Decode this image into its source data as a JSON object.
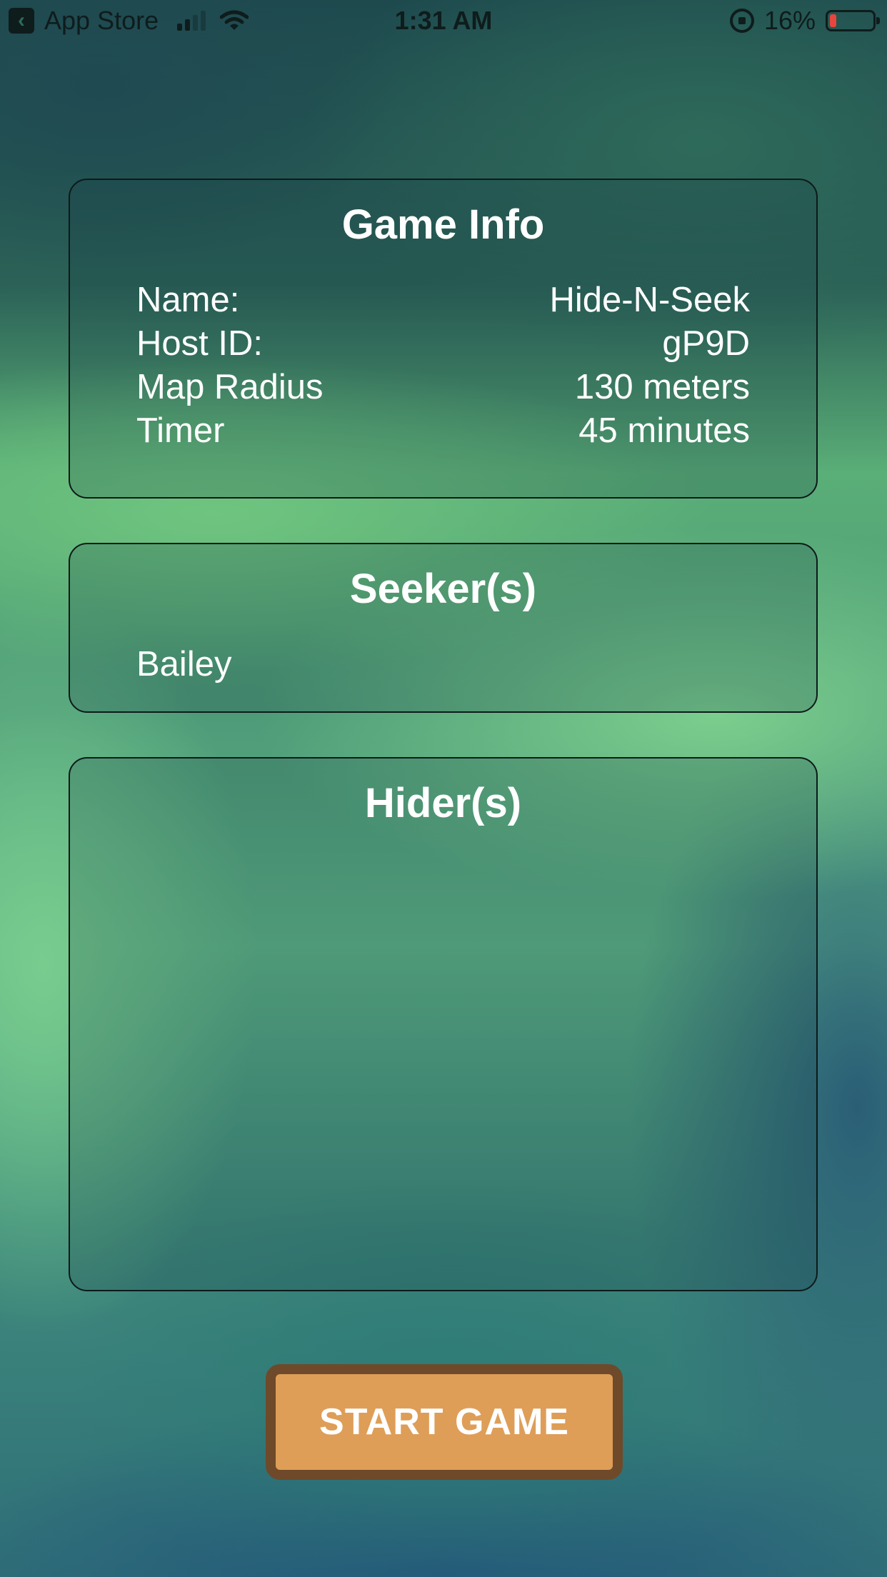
{
  "status_bar": {
    "back_label": "App Store",
    "time": "1:31 AM",
    "battery_text": "16%",
    "battery_level": 0.16,
    "battery_color": "#e8453c"
  },
  "game_info": {
    "title": "Game Info",
    "rows": [
      {
        "label": "Name:",
        "value": "Hide-N-Seek"
      },
      {
        "label": "Host ID:",
        "value": "gP9D"
      },
      {
        "label": "Map Radius",
        "value": "130 meters"
      },
      {
        "label": "Timer",
        "value": "45 minutes"
      }
    ]
  },
  "seekers": {
    "title": "Seeker(s)",
    "names": [
      "Bailey"
    ]
  },
  "hiders": {
    "title": "Hider(s)",
    "names": []
  },
  "actions": {
    "start_label": "START GAME",
    "start_color": "#de9e58",
    "start_border_color": "#6e4a2a"
  }
}
